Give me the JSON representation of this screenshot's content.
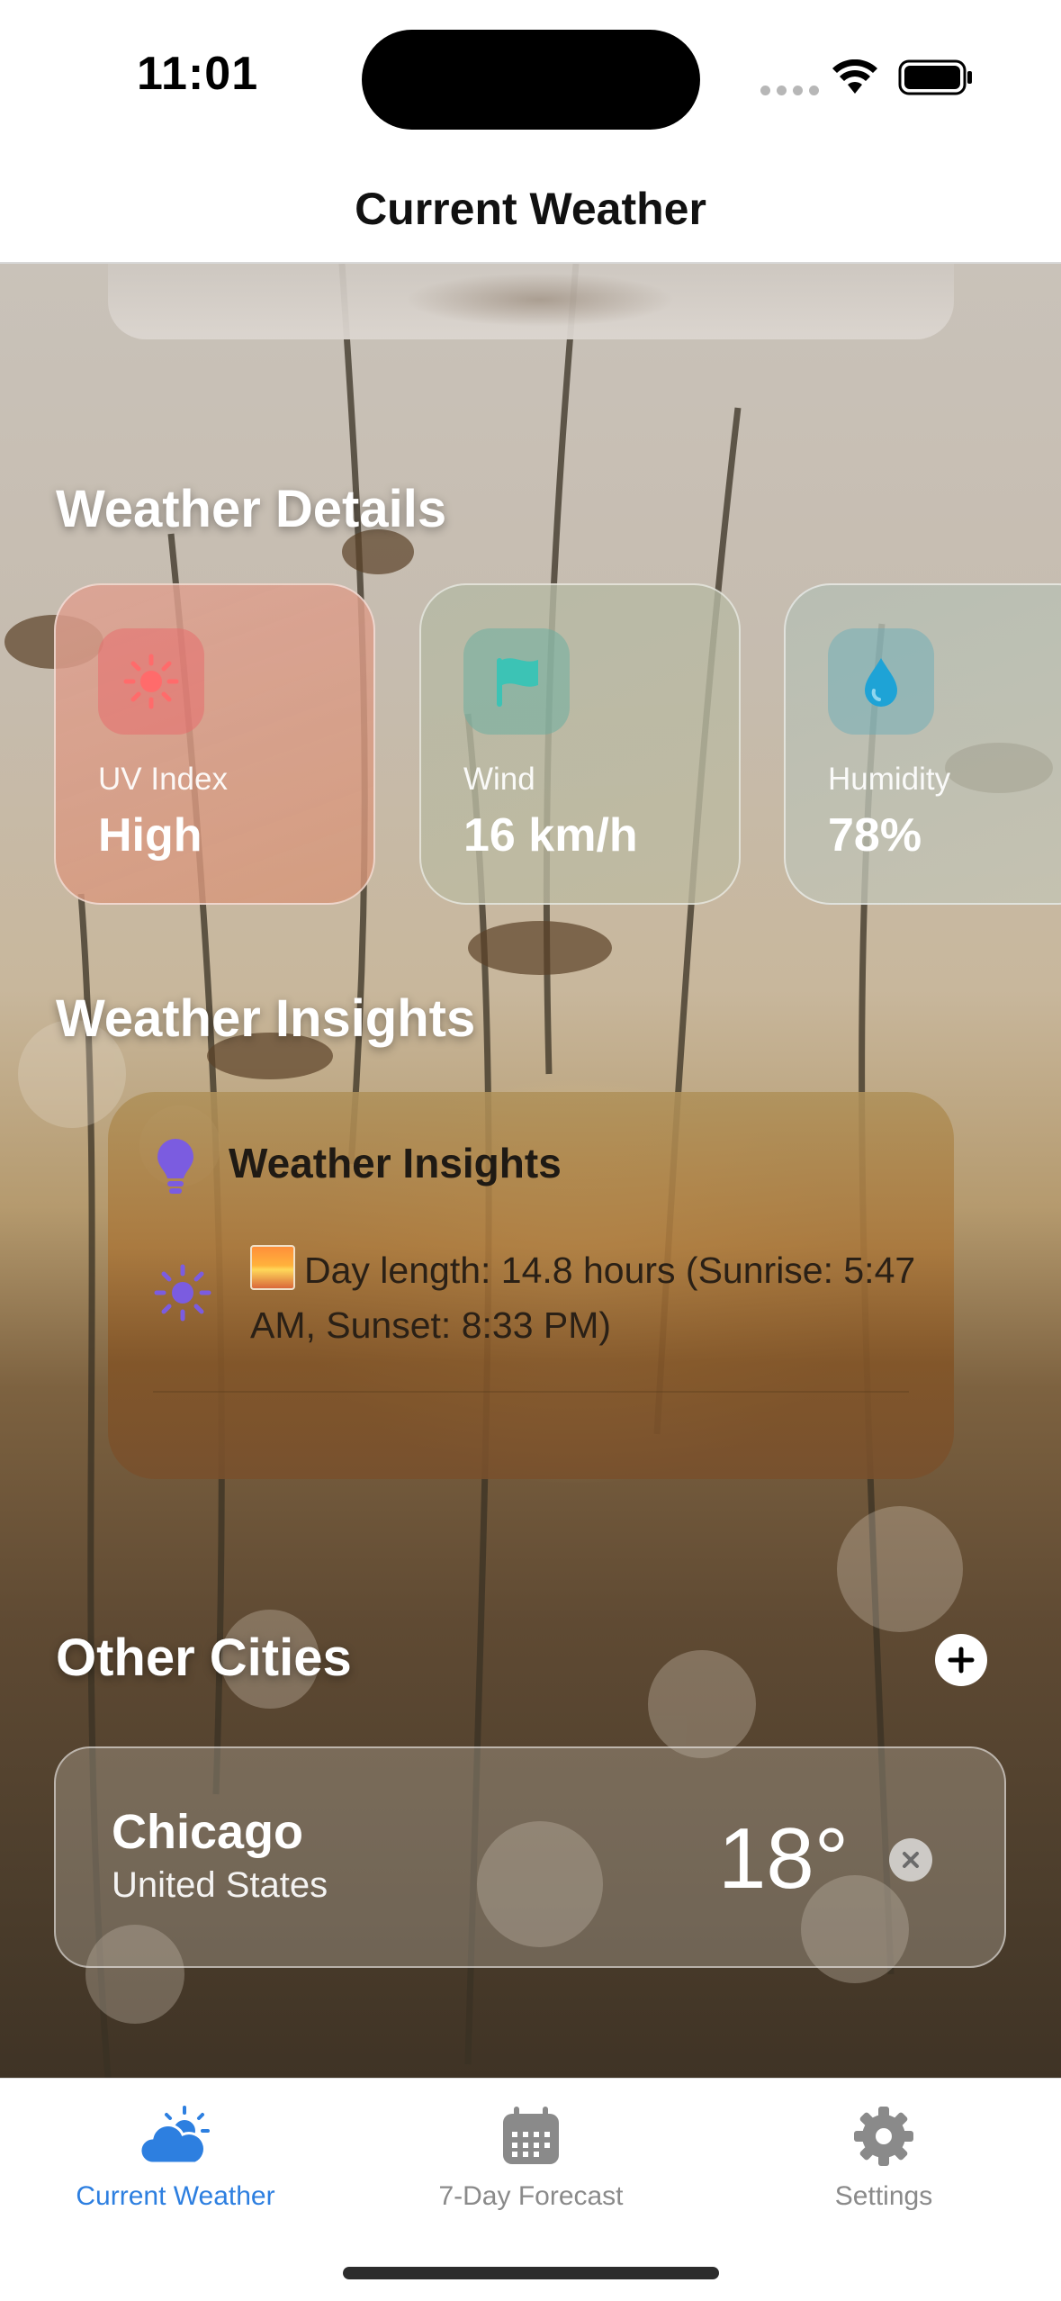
{
  "status_bar": {
    "time": "11:01"
  },
  "nav": {
    "title": "Current Weather"
  },
  "weather_details": {
    "title": "Weather Details",
    "cards": [
      {
        "label": "UV Index",
        "value": "High",
        "icon": "sun-icon",
        "color": "#ff6b6b"
      },
      {
        "label": "Wind",
        "value": "16 km/h",
        "icon": "flag-icon",
        "color": "#3cc3b5"
      },
      {
        "label": "Humidity",
        "value": "78%",
        "icon": "drop-icon",
        "color": "#1ea3d6"
      }
    ]
  },
  "insights": {
    "section_title": "Weather Insights",
    "card_title": "Weather Insights",
    "items": [
      {
        "icon": "sun-icon",
        "emoji": "sunrise-emoji",
        "text": "Day length: 14.8 hours (Sunrise: 5:47 AM, Sunset: 8:33 PM)"
      }
    ]
  },
  "other_cities": {
    "title": "Other Cities",
    "cities": [
      {
        "name": "Chicago",
        "country": "United States",
        "temp": "18°"
      }
    ]
  },
  "tabs": [
    {
      "label": "Current Weather",
      "icon": "cloud-sun-icon",
      "active": true
    },
    {
      "label": "7-Day Forecast",
      "icon": "calendar-icon",
      "active": false
    },
    {
      "label": "Settings",
      "icon": "gear-icon",
      "active": false
    }
  ],
  "colors": {
    "accent": "#2d7fe0",
    "insight_icon": "#7b5ce0"
  }
}
